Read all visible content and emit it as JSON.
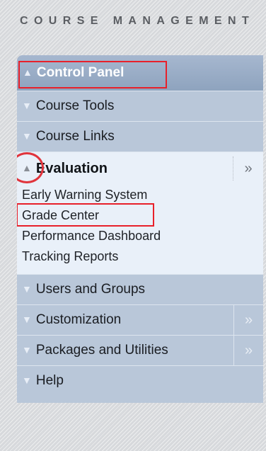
{
  "heading": "COURSE MANAGEMENT",
  "control_panel": {
    "label": "Control Panel",
    "icon": "chevron-up-double"
  },
  "items_top": [
    {
      "label": "Course Tools",
      "icon": "chevron-down-double"
    },
    {
      "label": "Course Links",
      "icon": "chevron-down-double"
    }
  ],
  "evaluation": {
    "label": "Evaluation",
    "expand_icon": "»",
    "subitems": [
      "Early Warning System",
      "Grade Center",
      "Performance Dashboard",
      "Tracking Reports"
    ]
  },
  "items_bottom": [
    {
      "label": "Users and Groups",
      "has_menu": false
    },
    {
      "label": "Customization",
      "has_menu": true,
      "menu_glyph": "»"
    },
    {
      "label": "Packages and Utilities",
      "has_menu": true,
      "menu_glyph": "»"
    },
    {
      "label": "Help",
      "has_menu": false
    }
  ],
  "colors": {
    "header_bg": "#8ea3be",
    "row_bg": "#b9c7d9",
    "expanded_bg": "#e9f0f9",
    "highlight": "#e8202a"
  }
}
